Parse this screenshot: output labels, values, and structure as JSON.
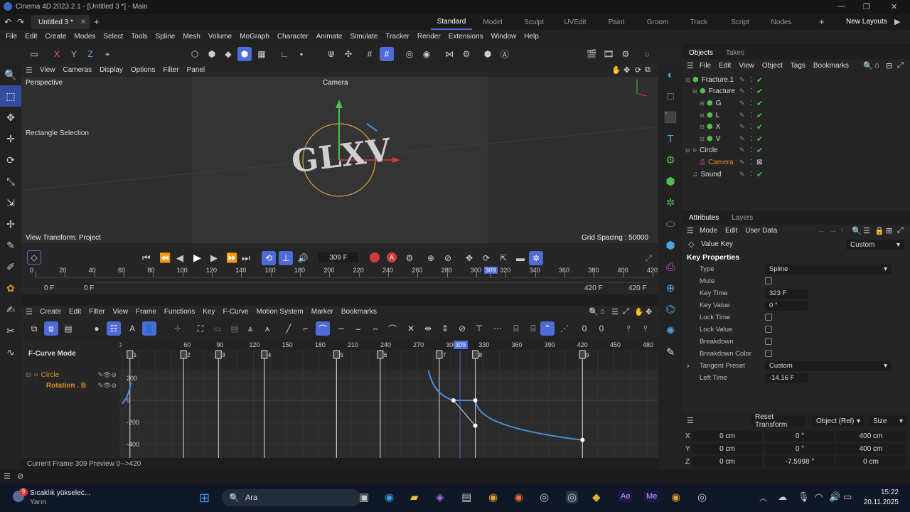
{
  "title_bar": {
    "text": "Cinema 4D 2023.2.1 - [Untitled 3 *] - Main",
    "controls": [
      "—",
      "❐",
      "✕"
    ]
  },
  "doc_tab": {
    "label": "Untitled 3 *",
    "plus": "+"
  },
  "layouts": {
    "items": [
      "Standard",
      "Model",
      "Sculpt",
      "UVEdit",
      "Paint",
      "Groom",
      "Track",
      "Script",
      "Nodes"
    ],
    "active": "Standard",
    "new_layouts": "New Layouts"
  },
  "menu": [
    "File",
    "Edit",
    "Create",
    "Modes",
    "Select",
    "Tools",
    "Spline",
    "Mesh",
    "Volume",
    "MoGraph",
    "Character",
    "Animate",
    "Simulate",
    "Tracker",
    "Render",
    "Extensions",
    "Window",
    "Help"
  ],
  "viewport": {
    "menu": [
      "View",
      "Cameras",
      "Display",
      "Options",
      "Filter",
      "Panel"
    ],
    "name": "Perspective",
    "camera": "Camera",
    "tool_label": "Rectangle Selection",
    "object_text": "GLXV",
    "view_transform": "View Transform: Project",
    "grid_spacing": "Grid Spacing : 50000 cm"
  },
  "transport": {
    "current_frame": "309 F",
    "ticks": [
      "0",
      "20",
      "40",
      "60",
      "80",
      "100",
      "120",
      "140",
      "160",
      "180",
      "200",
      "220",
      "240",
      "260",
      "280",
      "300",
      "309",
      "320",
      "340",
      "360",
      "380",
      "400",
      "420"
    ],
    "start_left": "0 F",
    "start_right": "0 F",
    "end_left": "420 F",
    "end_right": "420 F"
  },
  "fcurve": {
    "menu": [
      "Create",
      "Edit",
      "Filter",
      "View",
      "Frame",
      "Functions",
      "Key",
      "F-Curve",
      "Motion System",
      "Marker",
      "Bookmarks"
    ],
    "mode": "F-Curve Mode",
    "track_object": "Circle",
    "track_param": "Rotation . B",
    "ruler": [
      "0",
      "60",
      "90",
      "120",
      "150",
      "180",
      "210",
      "240",
      "270",
      "300",
      "309",
      "330",
      "360",
      "390",
      "420",
      "450",
      "480"
    ],
    "markers": [
      "1",
      "2",
      "3",
      "4",
      "5",
      "6",
      "7",
      "8",
      "9"
    ],
    "y_labels": [
      "200",
      "0",
      "-200",
      "-400"
    ],
    "status": "Current Frame  309  Preview  0-->420"
  },
  "objects": {
    "tabs": [
      "Objects",
      "Takes"
    ],
    "menu": [
      "File",
      "Edit",
      "View",
      "Object",
      "Tags",
      "Bookmarks"
    ],
    "items": [
      {
        "name": "Fracture.1",
        "level": 0
      },
      {
        "name": "Fracture",
        "level": 1
      },
      {
        "name": "G",
        "level": 2
      },
      {
        "name": "L",
        "level": 2
      },
      {
        "name": "X",
        "level": 2
      },
      {
        "name": "V",
        "level": 2
      },
      {
        "name": "Circle",
        "level": 0
      },
      {
        "name": "Camera",
        "level": 1
      },
      {
        "name": "Sound",
        "level": 0
      }
    ]
  },
  "attributes": {
    "tabs": [
      "Attributes",
      "Layers"
    ],
    "menu": [
      "Mode",
      "Edit",
      "User Data"
    ],
    "header": "Value Key",
    "header_value": "Custom",
    "section": "Key Properties",
    "rows": [
      {
        "label": "Type",
        "value": "Spline",
        "kind": "dropdown"
      },
      {
        "label": "Mute",
        "value": "",
        "kind": "checkbox"
      },
      {
        "label": "Key Time",
        "value": "323 F",
        "kind": "field"
      },
      {
        "label": "Key Value",
        "value": "0 °",
        "kind": "field"
      },
      {
        "label": "Lock Time",
        "value": "",
        "kind": "checkbox"
      },
      {
        "label": "Lock Value",
        "value": "",
        "kind": "checkbox"
      },
      {
        "label": "Breakdown",
        "value": "",
        "kind": "checkbox"
      },
      {
        "label": "Breakdown Color",
        "value": "",
        "kind": "checkbox"
      },
      {
        "label": "Tangent Preset",
        "value": "Custom",
        "kind": "dropdown"
      },
      {
        "label": "Left Time",
        "value": "-14.16 F",
        "kind": "field"
      }
    ]
  },
  "coords": {
    "buttons": [
      "Reset Transform",
      "Object (Rel)",
      "Size"
    ],
    "rows": [
      {
        "axis": "X",
        "pos": "0 cm",
        "rot": "0 °",
        "size": "400 cm"
      },
      {
        "axis": "Y",
        "pos": "0 cm",
        "rot": "0 °",
        "size": "400 cm"
      },
      {
        "axis": "Z",
        "pos": "0 cm",
        "rot": "-7.5998 °",
        "size": "0 cm"
      }
    ]
  },
  "taskbar": {
    "weather_title": "Sıcaklık yükselec...",
    "weather_sub": "Yarın",
    "search": "Ara",
    "time": "15:22",
    "date": "20.11.2025"
  },
  "colors": {
    "accent": "#4f6bd8",
    "curve": "#4a90d9",
    "check": "#4ec04e",
    "orange": "#e0902a"
  }
}
